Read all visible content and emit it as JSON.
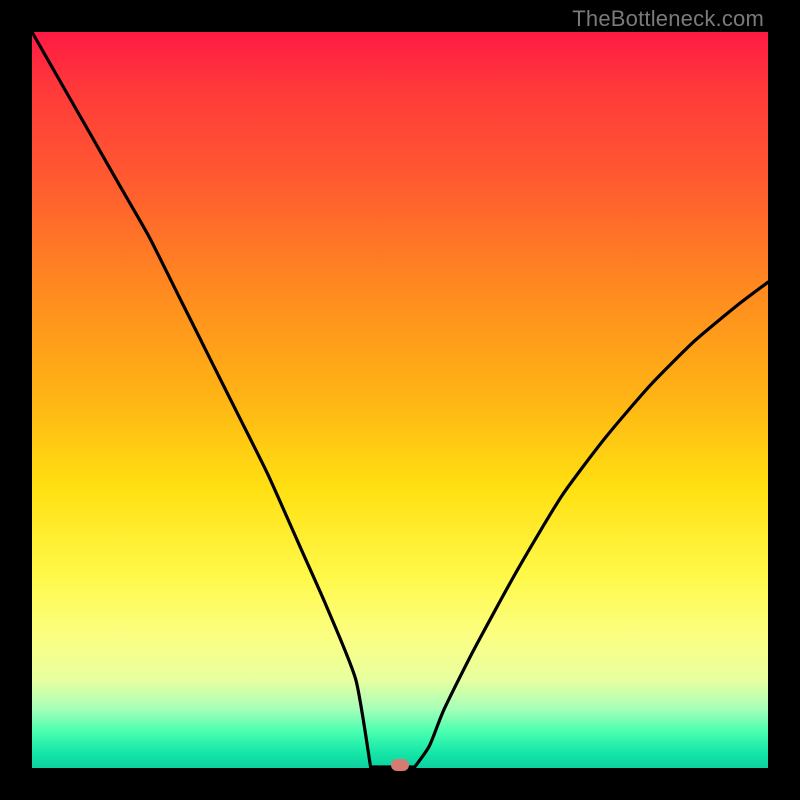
{
  "watermark": "TheBottleneck.com",
  "colors": {
    "frame": "#000000",
    "gradient_top": "#ff1a44",
    "gradient_bottom": "#0ecfa0",
    "curve": "#000000",
    "marker": "#d77a72"
  },
  "chart_data": {
    "type": "line",
    "title": "",
    "xlabel": "",
    "ylabel": "",
    "xlim": [
      0,
      100
    ],
    "ylim": [
      0,
      100
    ],
    "grid": false,
    "legend": false,
    "series": [
      {
        "name": "bottleneck-curve",
        "x": [
          0,
          4,
          8,
          12,
          16,
          20,
          24,
          28,
          32,
          36,
          40,
          44,
          46,
          48,
          50,
          52,
          54,
          56,
          60,
          66,
          72,
          78,
          84,
          90,
          96,
          100
        ],
        "y": [
          100,
          93,
          86,
          79,
          72,
          64,
          56,
          48,
          40,
          31,
          22,
          12,
          6,
          2,
          0,
          0,
          3,
          8,
          16,
          27,
          37,
          45,
          52,
          58,
          63,
          66
        ]
      }
    ],
    "marker": {
      "x": 50,
      "y": 0
    },
    "flat_segment": {
      "x_start": 46,
      "x_end": 52,
      "y": 0
    }
  }
}
